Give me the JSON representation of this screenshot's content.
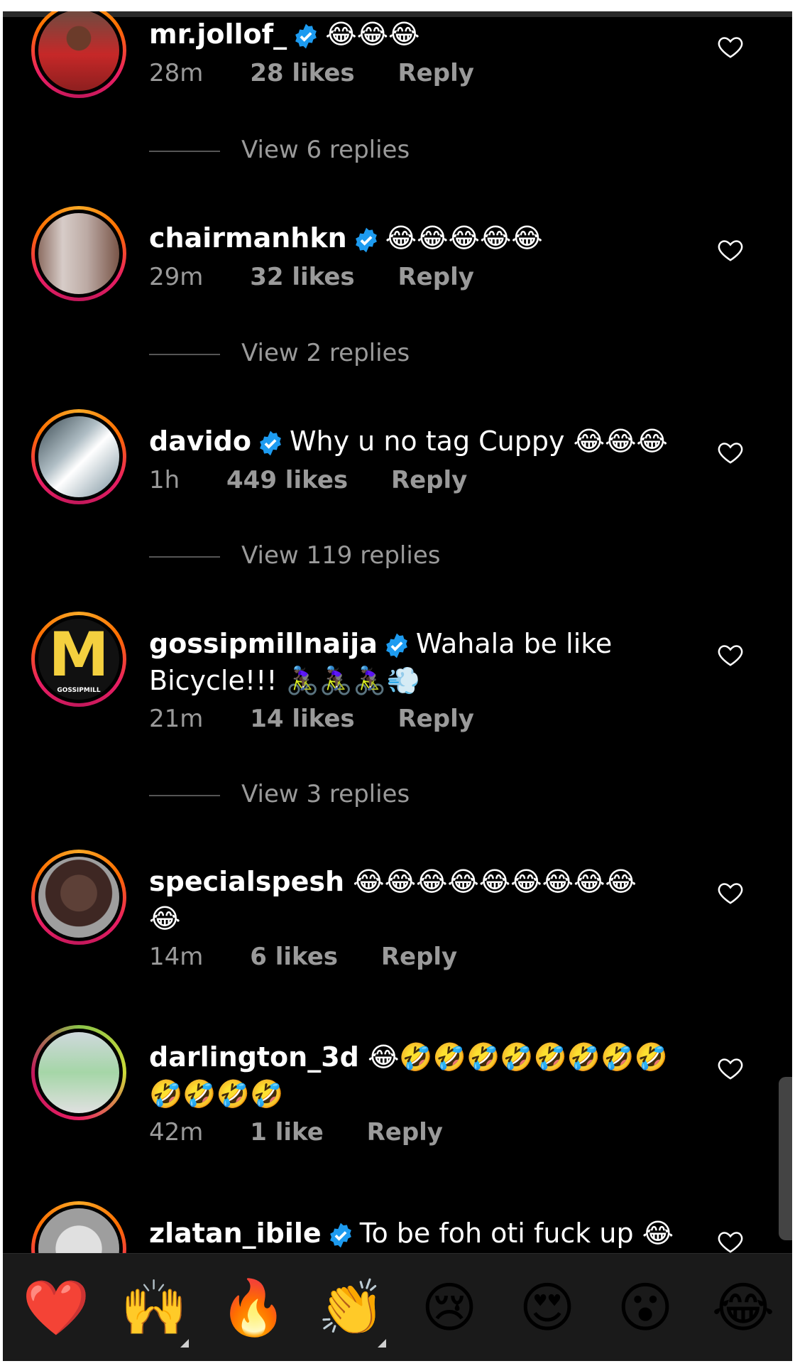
{
  "comments": [
    {
      "username": "mr.jollof_",
      "verified": true,
      "text": "😂😂😂",
      "time": "28m",
      "likes": "28 likes",
      "reply": "Reply",
      "view_replies": "View 6 replies"
    },
    {
      "username": "chairmanhkn",
      "verified": true,
      "text": "😂😂😂😂😂",
      "time": "29m",
      "likes": "32 likes",
      "reply": "Reply",
      "view_replies": "View 2 replies"
    },
    {
      "username": "davido",
      "verified": true,
      "text": "Why u no tag Cuppy 😂😂😂",
      "time": "1h",
      "likes": "449 likes",
      "reply": "Reply",
      "view_replies": "View 119 replies"
    },
    {
      "username": "gossipmillnaija",
      "verified": true,
      "text": "Wahala be like",
      "text2": "Bicycle!!! 🚴🏿‍♀️🚴🏿‍♀️🚴🏿‍♀️💨",
      "time": "21m",
      "likes": "14 likes",
      "reply": "Reply",
      "view_replies": "View 3 replies"
    },
    {
      "username": "specialspesh",
      "verified": false,
      "text": "😂😂😂😂😂😂😂😂😂",
      "text2": "😂",
      "time": "14m",
      "likes": "6 likes",
      "reply": "Reply"
    },
    {
      "username": "darlington_3d",
      "verified": false,
      "text": "😂🤣🤣🤣🤣🤣🤣🤣🤣",
      "text2": "🤣🤣🤣🤣",
      "time": "42m",
      "likes": "1 like",
      "reply": "Reply"
    },
    {
      "username": "zlatan_ibile",
      "verified": true,
      "text": "To be foh oti fuck up 😂"
    }
  ],
  "avatar_logo": {
    "letter": "M",
    "caption": "GOSSIPMILL"
  },
  "reactions": [
    "❤️",
    "🙌",
    "🔥",
    "👏",
    "😢",
    "😍",
    "😮",
    "😂"
  ],
  "colors": {
    "background": "#000000",
    "text": "#ffffff",
    "muted": "#9a9a9a",
    "verified": "#1d9bf0",
    "bar": "#1a1a1a"
  }
}
